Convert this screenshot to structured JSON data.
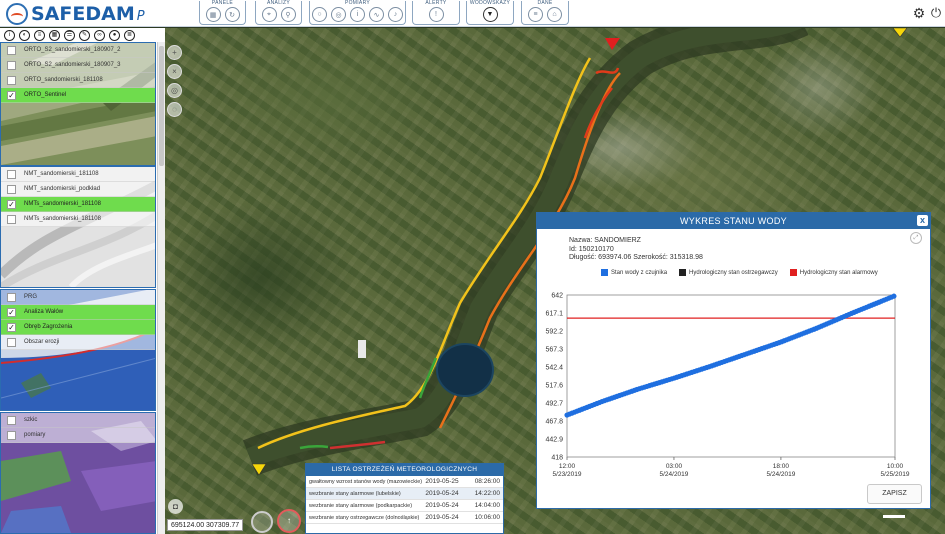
{
  "app": {
    "logo_text": "SAFEDAM",
    "logo_suffix": "P"
  },
  "toolbar_groups": [
    {
      "label": "PANELE",
      "buttons": [
        "grid-icon",
        "refresh-icon"
      ]
    },
    {
      "label": "ANALIZY",
      "buttons": [
        "pin-icon",
        "pin-outline-icon"
      ]
    },
    {
      "label": "POMIARY",
      "buttons": [
        "circle-icon",
        "compass-icon",
        "info-icon",
        "chart-icon",
        "bell-icon"
      ]
    },
    {
      "label": "ALERTY",
      "buttons": [
        "alert-icon"
      ]
    },
    {
      "label": "WODOWSKAZY",
      "buttons": [
        "gauge-icon"
      ]
    },
    {
      "label": "DANE",
      "buttons": [
        "data-icon",
        "tag-icon"
      ]
    }
  ],
  "layers": {
    "group1": [
      {
        "label": "ORTO_S2_sandomierski_180907_2",
        "checked": false
      },
      {
        "label": "ORTO_S2_sandomierski_180907_3",
        "checked": false
      },
      {
        "label": "ORTO_sandomierski_181108",
        "checked": false
      },
      {
        "label": "ORTO_Sentinel",
        "checked": true
      }
    ],
    "group2": [
      {
        "label": "NMT_sandomierski_181108",
        "checked": false
      },
      {
        "label": "NMT_sandomierski_podkład",
        "checked": false
      },
      {
        "label": "NMTs_sandomierski_181108",
        "checked": true
      },
      {
        "label": "NMTs_sandomierski_181108",
        "checked": false
      }
    ],
    "group3": [
      {
        "label": "PRG",
        "checked": false
      },
      {
        "label": "Analiza Wałów",
        "checked": true
      },
      {
        "label": "Obręb Zagrożenia",
        "checked": true
      },
      {
        "label": "Obszar erozji",
        "checked": false
      }
    ],
    "group4": [
      {
        "label": "szkic",
        "checked": false
      },
      {
        "label": "pomiary",
        "checked": false
      }
    ]
  },
  "chart_window": {
    "title": "WYKRES STANU WODY",
    "close_label": "x",
    "info": {
      "name": "Nazwa: SANDOMIERZ",
      "id": "Id: 150210170",
      "coords": "Długość: 693974.06 Szerokość: 315318.98"
    },
    "save_label": "ZAPISZ"
  },
  "chart_data": {
    "type": "scatter",
    "title": "",
    "xlabel": "",
    "ylabel": "",
    "y_ticks": [
      418,
      442.9,
      467.8,
      492.7,
      517.6,
      542.4,
      567.3,
      592.2,
      617.1,
      642
    ],
    "ylim": [
      418,
      642
    ],
    "x_ticks": [
      {
        "time": "12:00",
        "date": "5/23/2019"
      },
      {
        "time": "03:00",
        "date": "5/24/2019"
      },
      {
        "time": "18:00",
        "date": "5/24/2019"
      },
      {
        "time": "10:00",
        "date": "5/25/2019"
      }
    ],
    "x_tick_hours": [
      0,
      15,
      30,
      46
    ],
    "xlim_hours": [
      0,
      46
    ],
    "legend": [
      {
        "name": "Stan wody z czujnika",
        "color": "#1f6fe0"
      },
      {
        "name": "Hydrologiczny stan ostrzegawczy",
        "color": "#222222"
      },
      {
        "name": "Hydrologiczny stan alarmowy",
        "color": "#e02020"
      }
    ],
    "series": [
      {
        "name": "Stan wody z czujnika",
        "color": "#1f6fe0",
        "x_hours": [
          0,
          5,
          10,
          15,
          20,
          25,
          30,
          35,
          40,
          46
        ],
        "y": [
          476,
          495,
          512,
          527,
          543,
          560,
          577,
          596,
          617,
          641
        ]
      },
      {
        "name": "Hydrologiczny stan alarmowy",
        "color": "#e02020",
        "constant": 610
      }
    ],
    "grid": false,
    "legend_position": "top"
  },
  "alerts": {
    "title": "LISTA OSTRZEŻEŃ METEOROLOGICZNYCH",
    "rows": [
      {
        "name": "gwałtowny wzrost stanów wody (mazowieckie)",
        "date": "2019-05-25",
        "time": "08:26:00"
      },
      {
        "name": "wezbranie stany alarmowe  (lubelskie)",
        "date": "2019-05-24",
        "time": "14:22:00"
      },
      {
        "name": "wezbranie stany alarmowe  (podkarpackie)",
        "date": "2019-05-24",
        "time": "14:04:00"
      },
      {
        "name": "wezbranie stany ostrzegawcze (dolnośląskie)",
        "date": "2019-05-24",
        "time": "10:06:00"
      }
    ]
  },
  "coords_readout": "695124.00  307309.77"
}
